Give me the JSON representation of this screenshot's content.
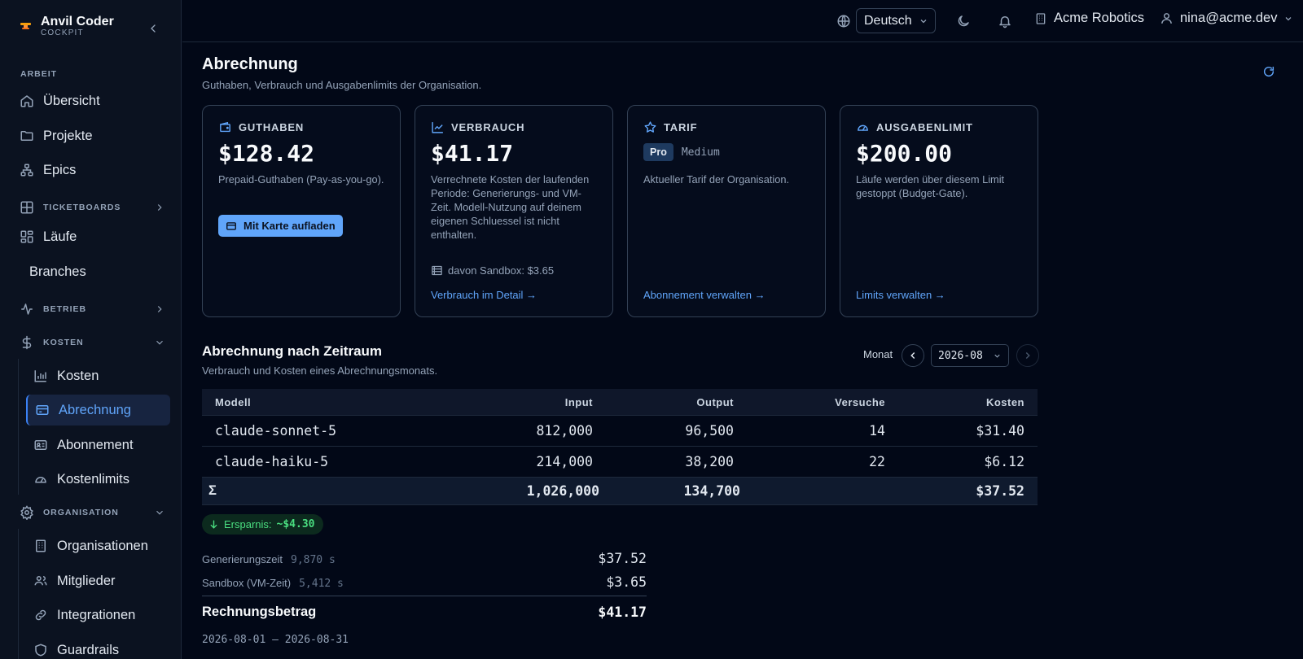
{
  "app": {
    "name": "Anvil Coder",
    "sub": "COCKPIT"
  },
  "sidebar": {
    "section_work": "ARBEIT",
    "items": {
      "overview": "Übersicht",
      "projects": "Projekte",
      "epics": "Epics",
      "runs": "Läufe",
      "branches": "Branches"
    },
    "groups": {
      "ticketboards": "TICKETBOARDS",
      "operations": "BETRIEB",
      "costs": "KOSTEN",
      "organisation": "ORGANISATION"
    },
    "cost_items": {
      "costs": "Kosten",
      "billing": "Abrechnung",
      "subscription": "Abonnement",
      "cost_limits": "Kostenlimits"
    },
    "org_items": {
      "organisations": "Organisationen",
      "members": "Mitglieder",
      "integrations": "Integrationen",
      "guardrails": "Guardrails"
    }
  },
  "topbar": {
    "language": "Deutsch",
    "org": "Acme Robotics",
    "user": "nina@acme.dev"
  },
  "page": {
    "title": "Abrechnung",
    "subtitle": "Guthaben, Verbrauch und Ausgabenlimits der Organisation."
  },
  "cards": {
    "balance": {
      "label": "GUTHABEN",
      "value": "$128.42",
      "desc": "Prepaid-Guthaben (Pay-as-you-go).",
      "button": "Mit Karte aufladen"
    },
    "usage": {
      "label": "VERBRAUCH",
      "value": "$41.17",
      "desc": "Verrechnete Kosten der laufenden Periode: Generierungs- und VM-Zeit. Modell-Nutzung auf deinem eigenen Schluessel ist nicht enthalten.",
      "sandbox": "davon Sandbox: $3.65",
      "link": "Verbrauch im Detail →"
    },
    "tier": {
      "label": "TARIF",
      "badge": "Pro",
      "size": "Medium",
      "desc": "Aktueller Tarif der Organisation.",
      "link": "Abonnement verwalten →"
    },
    "limit": {
      "label": "AUSGABENLIMIT",
      "value": "$200.00",
      "desc": "Läufe werden über diesem Limit gestoppt (Budget-Gate).",
      "link": "Limits verwalten →"
    }
  },
  "period_section": {
    "title": "Abrechnung nach Zeitraum",
    "subtitle": "Verbrauch und Kosten eines Abrechnungsmonats.",
    "month_label": "Monat",
    "month": "2026-08"
  },
  "table": {
    "headers": [
      "Modell",
      "Input",
      "Output",
      "Versuche",
      "Kosten"
    ],
    "rows": [
      [
        "claude-sonnet-5",
        "812,000",
        "96,500",
        "14",
        "$31.40"
      ],
      [
        "claude-haiku-5",
        "214,000",
        "38,200",
        "22",
        "$6.12"
      ]
    ],
    "sum": [
      "Σ",
      "1,026,000",
      "134,700",
      "",
      "$37.52"
    ]
  },
  "savings": {
    "label": "Ersparnis:",
    "value": "~$4.30"
  },
  "summary": {
    "generation": {
      "label": "Generierungszeit",
      "seconds": "9,870 s",
      "amount": "$37.52"
    },
    "sandbox": {
      "label": "Sandbox (VM-Zeit)",
      "seconds": "5,412 s",
      "amount": "$3.65"
    },
    "total": {
      "label": "Rechnungsbetrag",
      "amount": "$41.17"
    },
    "period": "2026-08-01 – 2026-08-31"
  },
  "colors": {
    "background": "#020817",
    "accent": "#60a5fa",
    "success": "#4ade80",
    "border": "#334155"
  }
}
